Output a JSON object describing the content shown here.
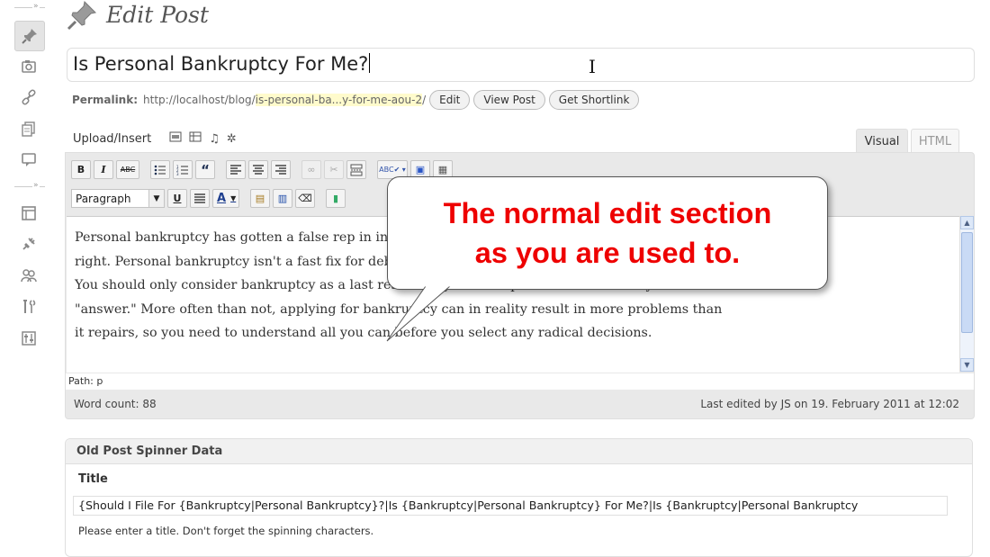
{
  "page": {
    "title": "Edit Post"
  },
  "post": {
    "title_value": "Is Personal Bankruptcy For Me?"
  },
  "permalink": {
    "label": "Permalink:",
    "base_url": "http://localhost/blog/",
    "slug": "is-personal-ba...y-for-me-aou-2",
    "trail": "/",
    "edit_label": "Edit",
    "view_label": "View Post",
    "shortlink_label": "Get Shortlink"
  },
  "media": {
    "upload_label": "Upload/Insert",
    "icons": [
      "image-icon",
      "video-icon",
      "audio-icon",
      "media-icon"
    ]
  },
  "tabs": {
    "visual": "Visual",
    "html": "HTML",
    "active": "Visual"
  },
  "toolbar": {
    "bold": "B",
    "italic": "I",
    "strike": "ABC",
    "format_select": "Paragraph",
    "underline": "U",
    "text_color": "A"
  },
  "editor": {
    "content": "Personal bankruptcy has gotten a false rep in in recent years, and it is time to make the record right. Personal bankruptcy isn't a fast fix for debt, and certainly is not the only choice available. You should only consider bankruptcy as a last resort for your debt problems as it is truly never a \"answer.\" More often than not, applying for bankruptcy can in reality result in more problems than it repairs, so you need to understand all you can before you select any radical decisions.",
    "path": "Path: p",
    "word_count": "Word count: 88",
    "last_edited": "Last edited by JS on 19. February 2011 at 12:02"
  },
  "callout": {
    "line1": "The normal edit section",
    "line2": "as you are used to."
  },
  "spinner": {
    "header": "Old Post Spinner Data",
    "title_label": "Title",
    "title_value": "{Should I File For {Bankruptcy|Personal Bankruptcy}?|Is {Bankruptcy|Personal Bankruptcy} For Me?|Is {Bankruptcy|Personal Bankruptcy",
    "help": "Please enter a title. Don't forget the spinning characters."
  },
  "colors": {
    "callout_text": "#ee0000",
    "slug_highlight": "#fffbcc",
    "editor_chrome": "#e9e9e9"
  }
}
